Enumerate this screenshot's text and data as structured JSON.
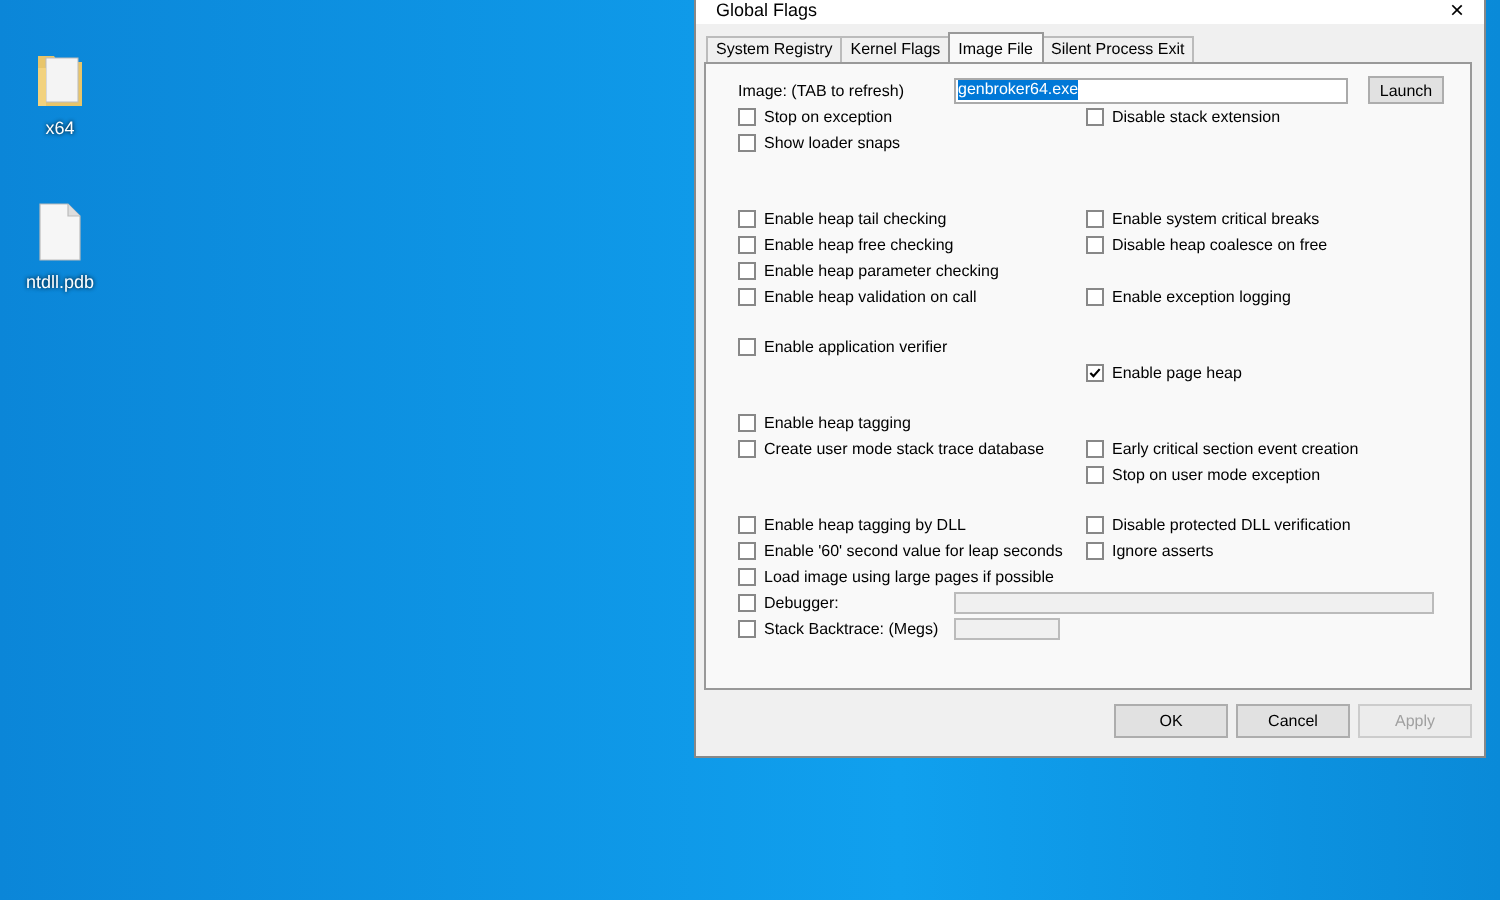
{
  "desktop_icons": [
    {
      "kind": "folder",
      "label": "x64"
    },
    {
      "kind": "file",
      "label": "ntdll.pdb"
    }
  ],
  "window": {
    "title": "Global Flags",
    "close": "×"
  },
  "tabs": [
    {
      "label": "System Registry",
      "selected": false
    },
    {
      "label": "Kernel Flags",
      "selected": false
    },
    {
      "label": "Image File",
      "selected": true
    },
    {
      "label": "Silent Process Exit",
      "selected": false
    }
  ],
  "image": {
    "label": "Image: (TAB to refresh)",
    "value": "genbroker64.exe",
    "launch": "Launch"
  },
  "sections": [
    {
      "rows": [
        {
          "left": {
            "kind": "checkbox",
            "label": "Stop on exception",
            "checked": false
          },
          "right": {
            "kind": "checkbox",
            "label": "Disable stack extension",
            "checked": false
          }
        },
        {
          "left": {
            "kind": "checkbox",
            "label": "Show loader snaps",
            "checked": false
          }
        }
      ]
    },
    {
      "rows": [
        {
          "left": {
            "kind": "checkbox",
            "label": "Enable heap tail checking",
            "checked": false
          },
          "right": {
            "kind": "checkbox",
            "label": "Enable system critical breaks",
            "checked": false
          }
        },
        {
          "left": {
            "kind": "checkbox",
            "label": "Enable heap free checking",
            "checked": false
          },
          "right": {
            "kind": "checkbox",
            "label": "Disable heap coalesce on free",
            "checked": false
          }
        },
        {
          "left": {
            "kind": "checkbox",
            "label": "Enable heap parameter checking",
            "checked": false
          }
        },
        {
          "left": {
            "kind": "checkbox",
            "label": "Enable heap validation on call",
            "checked": false
          },
          "right": {
            "kind": "checkbox",
            "label": "Enable exception logging",
            "checked": false
          }
        }
      ]
    },
    {
      "rows": [
        {
          "left": {
            "kind": "checkbox",
            "label": "Enable application verifier",
            "checked": false
          }
        },
        {
          "right": {
            "kind": "checkbox",
            "label": "Enable page heap",
            "checked": true
          }
        }
      ]
    },
    {
      "rows": [
        {
          "left": {
            "kind": "checkbox",
            "label": "Enable heap tagging",
            "checked": false
          }
        },
        {
          "left": {
            "kind": "checkbox",
            "label": "Create user mode stack trace database",
            "checked": false
          },
          "right": {
            "kind": "checkbox",
            "label": "Early critical section event creation",
            "checked": false
          }
        },
        {
          "right": {
            "kind": "checkbox",
            "label": "Stop on user mode exception",
            "checked": false
          }
        }
      ]
    },
    {
      "rows": [
        {
          "left": {
            "kind": "checkbox",
            "label": "Enable heap tagging by DLL",
            "checked": false
          },
          "right": {
            "kind": "checkbox",
            "label": "Disable protected DLL verification",
            "checked": false
          }
        },
        {
          "left": {
            "kind": "checkbox",
            "label": "Enable '60' second value for leap seconds",
            "checked": false
          },
          "right": {
            "kind": "checkbox",
            "label": "Ignore asserts",
            "checked": false
          }
        },
        {
          "left": {
            "kind": "checkbox",
            "label": "Load image using large pages if possible",
            "checked": false
          }
        },
        {
          "left": {
            "kind": "long-field",
            "label": "Debugger:",
            "checked": false
          }
        },
        {
          "left": {
            "kind": "short-field",
            "label": "Stack Backtrace: (Megs)",
            "checked": false
          }
        }
      ]
    }
  ],
  "buttons": [
    {
      "label": "OK",
      "disabled": false
    },
    {
      "label": "Cancel",
      "disabled": false
    },
    {
      "label": "Apply",
      "disabled": true
    }
  ]
}
